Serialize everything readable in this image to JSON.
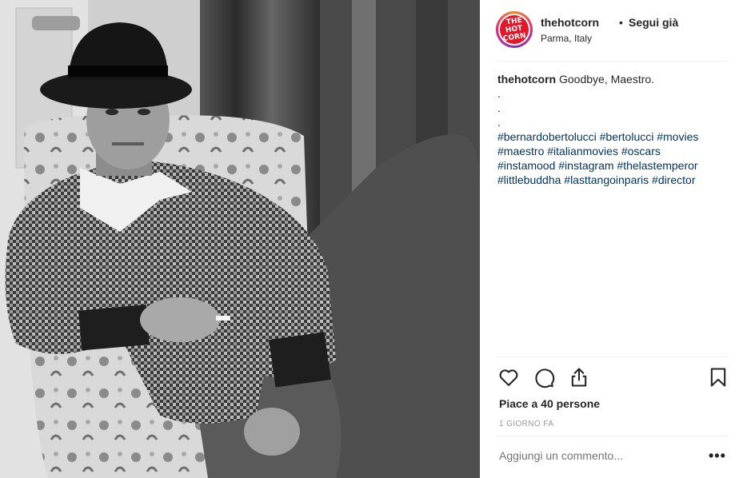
{
  "post": {
    "username": "thehotcorn",
    "separator": "•",
    "follow_label": "Segui già",
    "location": "Parma, Italy",
    "avatar_text": [
      "THE",
      "HOT",
      "CORN"
    ],
    "caption_user": "thehotcorn",
    "caption_text": "Goodbye, Maestro.",
    "caption_dots": [
      ".",
      ".",
      "."
    ],
    "hashtag_lines": [
      "#bernardobertolucci #bertolucci #movies",
      "#maestro #italianmovies #oscars",
      "#instamood #instagram #thelastemperor",
      "#littlebuddha #lasttangoinparis #director"
    ],
    "likes_text": "Piace a 40 persone",
    "time_text": "1 GIORNO FA",
    "comment_placeholder": "Aggiungi un commento...",
    "more_label": "•••"
  },
  "colors": {
    "hashtag": "#003569",
    "accent_logo": "#e4172a",
    "text": "#262626",
    "muted": "#999999"
  },
  "icons": [
    "heart-icon",
    "comment-icon",
    "share-icon",
    "bookmark-icon",
    "more-icon"
  ]
}
